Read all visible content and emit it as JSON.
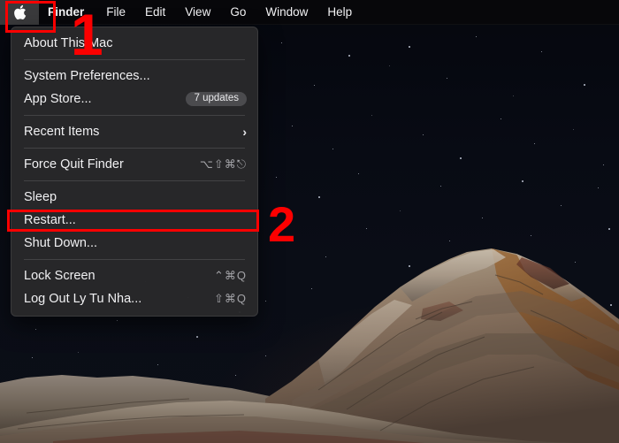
{
  "os": {
    "name": "macOS",
    "wallpaper": "big-sur-rock-formation-night"
  },
  "colors": {
    "annotation_red": "#fc0000",
    "menu_background": "#282a2a",
    "menubar_background": "#08080a",
    "text_primary": "#f0f0f2",
    "text_secondary": "#a2a2a6",
    "badge_background": "#4b4b4e"
  },
  "menubar": {
    "apple_icon": "apple-logo-icon",
    "items": [
      {
        "label": "Finder",
        "bold": true
      },
      {
        "label": "File",
        "bold": false
      },
      {
        "label": "Edit",
        "bold": false
      },
      {
        "label": "View",
        "bold": false
      },
      {
        "label": "Go",
        "bold": false
      },
      {
        "label": "Window",
        "bold": false
      },
      {
        "label": "Help",
        "bold": false
      }
    ]
  },
  "apple_menu": {
    "items": [
      {
        "label": "About This Mac",
        "shortcut": "",
        "badge": "",
        "submenu": false
      },
      {
        "label": "System Preferences...",
        "shortcut": "",
        "badge": "",
        "submenu": false
      },
      {
        "label": "App Store...",
        "shortcut": "",
        "badge": "7 updates",
        "submenu": false
      },
      {
        "label": "Recent Items",
        "shortcut": "",
        "badge": "",
        "submenu": true,
        "chevron": "›"
      },
      {
        "label": "Force Quit Finder",
        "shortcut": "⌥⇧⌘⎋",
        "badge": "",
        "submenu": false
      },
      {
        "label": "Sleep",
        "shortcut": "",
        "badge": "",
        "submenu": false
      },
      {
        "label": "Restart...",
        "shortcut": "",
        "badge": "",
        "submenu": false
      },
      {
        "label": "Shut Down...",
        "shortcut": "",
        "badge": "",
        "submenu": false
      },
      {
        "label": "Lock Screen",
        "shortcut": "⌃⌘Q",
        "badge": "",
        "submenu": false
      },
      {
        "label": "Log Out Ly Tu Nha...",
        "shortcut": "⇧⌘Q",
        "badge": "",
        "submenu": false
      }
    ]
  },
  "annotations": {
    "step_one": "1",
    "step_two": "2",
    "highlight_one_target": "apple-menu-bar-icon",
    "highlight_two_target": "restart-menu-item"
  }
}
